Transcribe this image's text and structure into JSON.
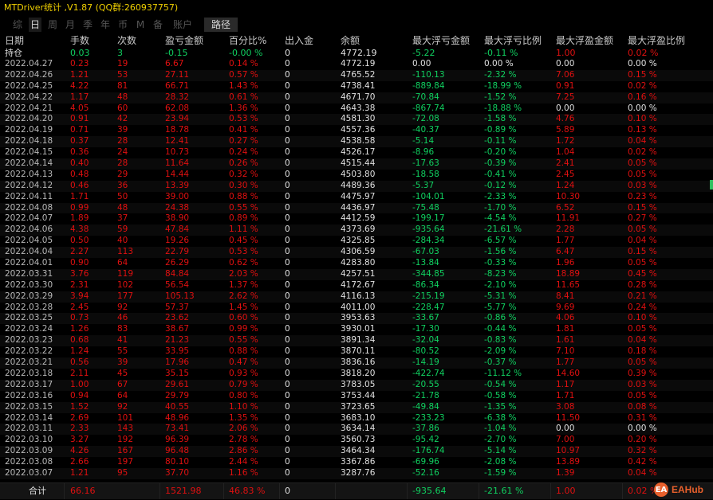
{
  "window": {
    "title": "MTDriver统计 ,V1.87 (QQ群:260937757)"
  },
  "tabs": [
    "综",
    "日",
    "周",
    "月",
    "季",
    "年",
    "币",
    "M",
    "备",
    "账户",
    "路径"
  ],
  "active_tab": "日",
  "columns": [
    "日期",
    "手数",
    "次数",
    "盈亏金额",
    "百分比%",
    "出入金",
    "余额",
    "最大浮亏金额",
    "最大浮亏比例",
    "最大浮盈金额",
    "最大浮盈比例"
  ],
  "holding": [
    "持仓",
    "0.03",
    "3",
    "-0.15",
    "-0.00 %",
    "0",
    "4772.19",
    "-5.22",
    "-0.11 %",
    "1.00",
    "0.02 %"
  ],
  "rows": [
    [
      "2022.04.27",
      "0.23",
      "19",
      "6.67",
      "0.14 %",
      "0",
      "4772.19",
      "0.00",
      "0.00 %",
      "0.00",
      "0.00 %"
    ],
    [
      "2022.04.26",
      "1.21",
      "53",
      "27.11",
      "0.57 %",
      "0",
      "4765.52",
      "-110.13",
      "-2.32 %",
      "7.06",
      "0.15 %"
    ],
    [
      "2022.04.25",
      "4.22",
      "81",
      "66.71",
      "1.43 %",
      "0",
      "4738.41",
      "-889.84",
      "-18.99 %",
      "0.91",
      "0.02 %"
    ],
    [
      "2022.04.22",
      "1.17",
      "48",
      "28.32",
      "0.61 %",
      "0",
      "4671.70",
      "-70.84",
      "-1.52 %",
      "7.25",
      "0.16 %"
    ],
    [
      "2022.04.21",
      "4.05",
      "60",
      "62.08",
      "1.36 %",
      "0",
      "4643.38",
      "-867.74",
      "-18.88 %",
      "0.00",
      "0.00 %"
    ],
    [
      "2022.04.20",
      "0.91",
      "42",
      "23.94",
      "0.53 %",
      "0",
      "4581.30",
      "-72.08",
      "-1.58 %",
      "4.76",
      "0.10 %"
    ],
    [
      "2022.04.19",
      "0.71",
      "39",
      "18.78",
      "0.41 %",
      "0",
      "4557.36",
      "-40.37",
      "-0.89 %",
      "5.89",
      "0.13 %"
    ],
    [
      "2022.04.18",
      "0.37",
      "28",
      "12.41",
      "0.27 %",
      "0",
      "4538.58",
      "-5.14",
      "-0.11 %",
      "1.72",
      "0.04 %"
    ],
    [
      "2022.04.15",
      "0.36",
      "24",
      "10.73",
      "0.24 %",
      "0",
      "4526.17",
      "-8.96",
      "-0.20 %",
      "1.04",
      "0.02 %"
    ],
    [
      "2022.04.14",
      "0.40",
      "28",
      "11.64",
      "0.26 %",
      "0",
      "4515.44",
      "-17.63",
      "-0.39 %",
      "2.41",
      "0.05 %"
    ],
    [
      "2022.04.13",
      "0.48",
      "29",
      "14.44",
      "0.32 %",
      "0",
      "4503.80",
      "-18.58",
      "-0.41 %",
      "2.45",
      "0.05 %"
    ],
    [
      "2022.04.12",
      "0.46",
      "36",
      "13.39",
      "0.30 %",
      "0",
      "4489.36",
      "-5.37",
      "-0.12 %",
      "1.24",
      "0.03 %"
    ],
    [
      "2022.04.11",
      "1.71",
      "50",
      "39.00",
      "0.88 %",
      "0",
      "4475.97",
      "-104.01",
      "-2.33 %",
      "10.30",
      "0.23 %"
    ],
    [
      "2022.04.08",
      "0.99",
      "48",
      "24.38",
      "0.55 %",
      "0",
      "4436.97",
      "-75.48",
      "-1.70 %",
      "6.52",
      "0.15 %"
    ],
    [
      "2022.04.07",
      "1.89",
      "37",
      "38.90",
      "0.89 %",
      "0",
      "4412.59",
      "-199.17",
      "-4.54 %",
      "11.91",
      "0.27 %"
    ],
    [
      "2022.04.06",
      "4.38",
      "59",
      "47.84",
      "1.11 %",
      "0",
      "4373.69",
      "-935.64",
      "-21.61 %",
      "2.28",
      "0.05 %"
    ],
    [
      "2022.04.05",
      "0.50",
      "40",
      "19.26",
      "0.45 %",
      "0",
      "4325.85",
      "-284.34",
      "-6.57 %",
      "1.77",
      "0.04 %"
    ],
    [
      "2022.04.04",
      "2.27",
      "113",
      "22.79",
      "0.53 %",
      "0",
      "4306.59",
      "-67.03",
      "-1.56 %",
      "6.47",
      "0.15 %"
    ],
    [
      "2022.04.01",
      "0.90",
      "64",
      "26.29",
      "0.62 %",
      "0",
      "4283.80",
      "-13.84",
      "-0.33 %",
      "1.96",
      "0.05 %"
    ],
    [
      "2022.03.31",
      "3.76",
      "119",
      "84.84",
      "2.03 %",
      "0",
      "4257.51",
      "-344.85",
      "-8.23 %",
      "18.89",
      "0.45 %"
    ],
    [
      "2022.03.30",
      "2.31",
      "102",
      "56.54",
      "1.37 %",
      "0",
      "4172.67",
      "-86.34",
      "-2.10 %",
      "11.65",
      "0.28 %"
    ],
    [
      "2022.03.29",
      "3.94",
      "177",
      "105.13",
      "2.62 %",
      "0",
      "4116.13",
      "-215.19",
      "-5.31 %",
      "8.41",
      "0.21 %"
    ],
    [
      "2022.03.28",
      "2.45",
      "92",
      "57.37",
      "1.45 %",
      "0",
      "4011.00",
      "-228.47",
      "-5.77 %",
      "9.69",
      "0.24 %"
    ],
    [
      "2022.03.25",
      "0.73",
      "46",
      "23.62",
      "0.60 %",
      "0",
      "3953.63",
      "-33.67",
      "-0.86 %",
      "4.06",
      "0.10 %"
    ],
    [
      "2022.03.24",
      "1.26",
      "83",
      "38.67",
      "0.99 %",
      "0",
      "3930.01",
      "-17.30",
      "-0.44 %",
      "1.81",
      "0.05 %"
    ],
    [
      "2022.03.23",
      "0.68",
      "41",
      "21.23",
      "0.55 %",
      "0",
      "3891.34",
      "-32.04",
      "-0.83 %",
      "1.61",
      "0.04 %"
    ],
    [
      "2022.03.22",
      "1.24",
      "55",
      "33.95",
      "0.88 %",
      "0",
      "3870.11",
      "-80.52",
      "-2.09 %",
      "7.10",
      "0.18 %"
    ],
    [
      "2022.03.21",
      "0.56",
      "39",
      "17.96",
      "0.47 %",
      "0",
      "3836.16",
      "-14.19",
      "-0.37 %",
      "1.77",
      "0.05 %"
    ],
    [
      "2022.03.18",
      "2.11",
      "45",
      "35.15",
      "0.93 %",
      "0",
      "3818.20",
      "-422.74",
      "-11.12 %",
      "14.60",
      "0.39 %"
    ],
    [
      "2022.03.17",
      "1.00",
      "67",
      "29.61",
      "0.79 %",
      "0",
      "3783.05",
      "-20.55",
      "-0.54 %",
      "1.17",
      "0.03 %"
    ],
    [
      "2022.03.16",
      "0.94",
      "64",
      "29.79",
      "0.80 %",
      "0",
      "3753.44",
      "-21.78",
      "-0.58 %",
      "1.71",
      "0.05 %"
    ],
    [
      "2022.03.15",
      "1.52",
      "92",
      "40.55",
      "1.10 %",
      "0",
      "3723.65",
      "-49.84",
      "-1.35 %",
      "3.08",
      "0.08 %"
    ],
    [
      "2022.03.14",
      "2.69",
      "101",
      "48.96",
      "1.35 %",
      "0",
      "3683.10",
      "-233.23",
      "-6.38 %",
      "11.50",
      "0.31 %"
    ],
    [
      "2022.03.11",
      "2.33",
      "143",
      "73.41",
      "2.06 %",
      "0",
      "3634.14",
      "-37.86",
      "-1.04 %",
      "0.00",
      "0.00 %"
    ],
    [
      "2022.03.10",
      "3.27",
      "192",
      "96.39",
      "2.78 %",
      "0",
      "3560.73",
      "-95.42",
      "-2.70 %",
      "7.00",
      "0.20 %"
    ],
    [
      "2022.03.09",
      "4.26",
      "167",
      "96.48",
      "2.86 %",
      "0",
      "3464.34",
      "-176.74",
      "-5.14 %",
      "10.97",
      "0.32 %"
    ],
    [
      "2022.03.08",
      "2.66",
      "197",
      "80.10",
      "2.44 %",
      "0",
      "3367.86",
      "-69.96",
      "-2.08 %",
      "13.89",
      "0.42 %"
    ],
    [
      "2022.03.07",
      "1.21",
      "95",
      "37.70",
      "1.16 %",
      "0",
      "3287.76",
      "-52.16",
      "-1.59 %",
      "1.39",
      "0.04 %"
    ]
  ],
  "total": [
    "合计",
    "66.16",
    "",
    "1521.98",
    "46.83 %",
    "0",
    "",
    "-935.64",
    "-21.61 %",
    "1.00",
    "0.02 %"
  ],
  "logo": {
    "badge": "EA",
    "text": "EAHub"
  },
  "colors": {
    "positive": "#e01010",
    "negative": "#10d060",
    "neutral": "#e0e0e0",
    "title": "#f0d000",
    "logo": "#e8602c"
  }
}
